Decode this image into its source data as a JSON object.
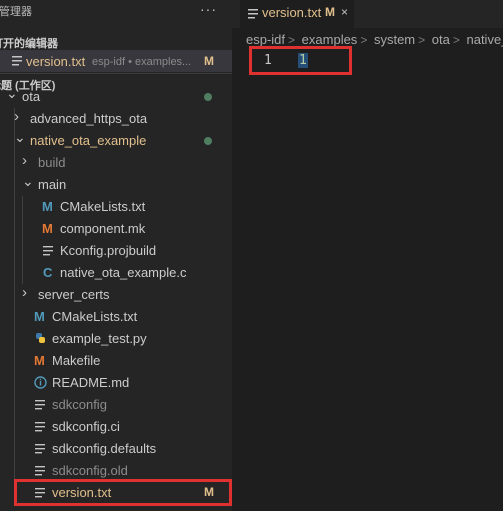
{
  "sidebar": {
    "title": "源管理器",
    "more_label": "···",
    "open_editors_heading": "打开的编辑器",
    "open_editor": {
      "name": "version.txt",
      "description": "esp-idf • examples...",
      "status": "M"
    },
    "workspace_heading": "标题 (工作区)",
    "tree": [
      {
        "label": "ota",
        "kind": "folder-open",
        "depth": 0,
        "color": "#cccccc",
        "decoration": "dot"
      },
      {
        "label": "advanced_https_ota",
        "kind": "folder-closed",
        "depth": 1,
        "color": "#cccccc"
      },
      {
        "label": "native_ota_example",
        "kind": "folder-open",
        "depth": 1,
        "color": "#e2c08d",
        "decoration": "dot"
      },
      {
        "label": "build",
        "kind": "folder-closed",
        "depth": 2,
        "color": "#8c8c8c"
      },
      {
        "label": "main",
        "kind": "folder-open",
        "depth": 2,
        "color": "#cccccc"
      },
      {
        "label": "CMakeLists.txt",
        "kind": "cmake",
        "depth": 3,
        "color": "#cccccc"
      },
      {
        "label": "component.mk",
        "kind": "make",
        "depth": 3,
        "color": "#cccccc"
      },
      {
        "label": "Kconfig.projbuild",
        "kind": "text",
        "depth": 3,
        "color": "#cccccc"
      },
      {
        "label": "native_ota_example.c",
        "kind": "c",
        "depth": 3,
        "color": "#cccccc"
      },
      {
        "label": "server_certs",
        "kind": "folder-closed",
        "depth": 2,
        "color": "#cccccc"
      },
      {
        "label": "CMakeLists.txt",
        "kind": "cmake",
        "depth": 2,
        "color": "#cccccc"
      },
      {
        "label": "example_test.py",
        "kind": "python",
        "depth": 2,
        "color": "#cccccc"
      },
      {
        "label": "Makefile",
        "kind": "make",
        "depth": 2,
        "color": "#cccccc"
      },
      {
        "label": "README.md",
        "kind": "info",
        "depth": 2,
        "color": "#cccccc"
      },
      {
        "label": "sdkconfig",
        "kind": "text",
        "depth": 2,
        "color": "#8c8c8c"
      },
      {
        "label": "sdkconfig.ci",
        "kind": "text",
        "depth": 2,
        "color": "#cccccc"
      },
      {
        "label": "sdkconfig.defaults",
        "kind": "text",
        "depth": 2,
        "color": "#cccccc"
      },
      {
        "label": "sdkconfig.old",
        "kind": "text",
        "depth": 2,
        "color": "#8c8c8c"
      },
      {
        "label": "version.txt",
        "kind": "text",
        "depth": 2,
        "color": "#e2c08d",
        "decoration": "M",
        "highlight": true
      }
    ]
  },
  "editor": {
    "tab": {
      "label": "version.txt",
      "status": "M",
      "close": "×"
    },
    "breadcrumb": [
      "esp-idf",
      "examples",
      "system",
      "ota",
      "native_"
    ],
    "lines": [
      {
        "number": "1",
        "text": "1"
      }
    ]
  },
  "colors": {
    "highlight_box": "#e03131",
    "modified": "#e2c08d",
    "untracked": "#73c991"
  }
}
